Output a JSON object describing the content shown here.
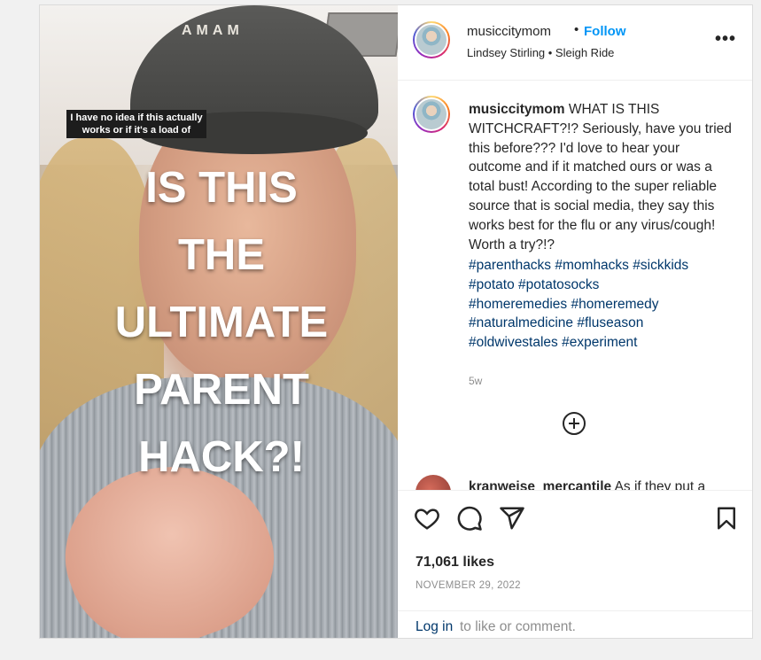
{
  "media": {
    "cap_brand": "AMAM",
    "small_caption": "I have no idea if this actually works or if it's a load of",
    "big_caption_lines": [
      "IS THIS",
      "THE",
      "ULTIMATE",
      "PARENT",
      "HACK?!"
    ]
  },
  "header": {
    "username": "musiccitymom",
    "separator": "•",
    "follow_label": "Follow",
    "audio": "Lindsey Stirling • Sleigh Ride",
    "more_label": "•••"
  },
  "caption": {
    "username": "musiccitymom",
    "text": "WHAT IS THIS WITCHCRAFT?!? Seriously, have you tried this before??? I'd love to hear your outcome and if it matched ours or was a total bust! According to the super reliable source that is social media, they say this works best for the flu or any virus/cough! Worth a try?!?",
    "hashtags": [
      "#parenthacks",
      "#momhacks",
      "#sickkids",
      "#potato",
      "#potatosocks",
      "#homeremedies",
      "#homeremedy",
      "#naturalmedicine",
      "#fluseason",
      "#oldwivestales",
      "#experiment"
    ],
    "age": "5w"
  },
  "next_comment": {
    "username": "kranweise_mercantile",
    "text": "As if they put a"
  },
  "icons": {
    "like": "heart-icon",
    "comment": "comment-icon",
    "share": "share-icon",
    "save": "bookmark-icon",
    "load_more": "plus-circle-icon"
  },
  "stats": {
    "likes": "71,061 likes",
    "date": "NOVEMBER 29, 2022"
  },
  "login": {
    "link": "Log in",
    "rest": "to like or comment."
  },
  "colors": {
    "link_blue": "#0095f6",
    "hashtag": "#00376b",
    "muted": "#8e8e8e"
  }
}
